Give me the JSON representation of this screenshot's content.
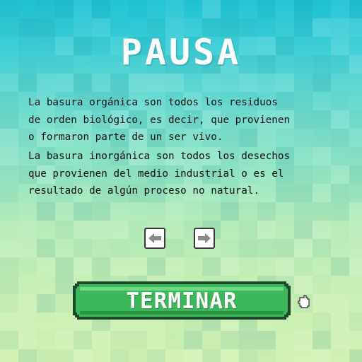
{
  "pause_screen": {
    "title": "PAUSA",
    "paragraphs": [
      "La basura orgánica son todos los residuos\nde orden biológico, es decir, que provienen\no formaron parte de un ser vivo.",
      "La basura inorgánica son todos los desechos\nque provienen del medio industrial o es el\nresultado de algún proceso no natural."
    ],
    "nav": {
      "prev_icon": "arrow-left-icon",
      "next_icon": "arrow-right-icon"
    },
    "finish_button": {
      "label": "TERMINAR"
    },
    "pointer_icon": "hand-pointer-icon"
  },
  "colors": {
    "background_top": "#1fc3d6",
    "background_bottom": "#d2f2b2",
    "title": "#ffffff",
    "body_text": "#111111",
    "button_fill": "#3cb85a",
    "button_border": "#1b4a2a"
  }
}
